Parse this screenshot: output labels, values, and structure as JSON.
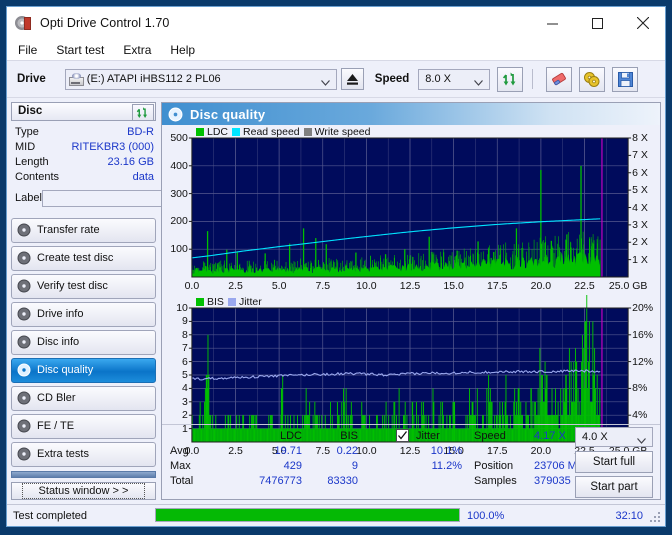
{
  "window": {
    "title": "Opti Drive Control 1.70",
    "icon": "optical-disc-icon",
    "minimize": "minimize",
    "maximize": "maximize",
    "close": "close"
  },
  "menu": {
    "items": [
      "File",
      "Start test",
      "Extra",
      "Help"
    ]
  },
  "toolbar": {
    "drive_label": "Drive",
    "drive_value": "(E:)   ATAPI iHBS112  2 PL06",
    "eject": "eject",
    "speed_label": "Speed",
    "speed_value": "8.0 X",
    "refresh_icon": "refresh-icon",
    "erase_icon": "erase-icon",
    "discs_icon": "discs-icon",
    "save_icon": "save-icon"
  },
  "disc": {
    "header": "Disc",
    "refresh_icon": "refresh-icon",
    "rows": [
      {
        "key": "Type",
        "value": "BD-R"
      },
      {
        "key": "MID",
        "value": "RITEKBR3 (000)"
      },
      {
        "key": "Length",
        "value": "23.16 GB"
      },
      {
        "key": "Contents",
        "value": "data"
      }
    ],
    "label_key": "Label",
    "label_value": "",
    "label_placeholder": "",
    "label_button_icon": "disc-label-icon"
  },
  "nav": {
    "items": [
      {
        "label": "Transfer rate",
        "selected": false
      },
      {
        "label": "Create test disc",
        "selected": false
      },
      {
        "label": "Verify test disc",
        "selected": false
      },
      {
        "label": "Drive info",
        "selected": false
      },
      {
        "label": "Disc info",
        "selected": false
      },
      {
        "label": "Disc quality",
        "selected": true
      },
      {
        "label": "CD Bler",
        "selected": false
      },
      {
        "label": "FE / TE",
        "selected": false
      },
      {
        "label": "Extra tests",
        "selected": false
      }
    ],
    "status_window": "Status window > >"
  },
  "panel": {
    "title": "Disc quality",
    "icon": "disc-quality-icon"
  },
  "stats": {
    "col_ldc": "LDC",
    "col_bis": "BIS",
    "row_avg": "Avg",
    "row_max": "Max",
    "row_total": "Total",
    "ldc_avg": "19.71",
    "ldc_max": "429",
    "ldc_total": "7476773",
    "bis_avg": "0.22",
    "bis_max": "9",
    "bis_total": "83330",
    "jitter_label": "Jitter",
    "jitter_checked": true,
    "jitter_avg": "10.1%",
    "jitter_max": "11.2%",
    "speed_label": "Speed",
    "speed_value": "4.17 X",
    "position_label": "Position",
    "position_value": "23706 MB",
    "samples_label": "Samples",
    "samples_value": "379035",
    "speed_select": "4.0 X",
    "start_full": "Start full",
    "start_part": "Start part"
  },
  "statusbar": {
    "text": "Test completed",
    "progress_pct": 100,
    "progress_label": "100.0%",
    "elapsed": "32:10"
  },
  "colors": {
    "ldc_green": "#00c000",
    "read_speed_cyan": "#00e5ff",
    "write_speed_gray": "#808080",
    "bis_green": "#00c000",
    "jitter_periwinkle": "#9aa8ee",
    "plot_bg": "#000b5c",
    "grid": "#55598f",
    "accent_blue": "#1b37c9",
    "marker_magenta": "#c000c0"
  },
  "chart_data": [
    {
      "type": "area",
      "id": "ldc-chart",
      "title": "",
      "xlabel": "GB",
      "ylabel": "",
      "xlim": [
        0,
        25
      ],
      "ylim": [
        0,
        500
      ],
      "y2lim": [
        0,
        8
      ],
      "y2label": "X",
      "grid": true,
      "legend": [
        "LDC",
        "Read speed",
        "Write speed"
      ],
      "legend_position": "top-left",
      "xticks": [
        "0.0",
        "2.5",
        "5.0",
        "7.5",
        "10.0",
        "12.5",
        "15.0",
        "17.5",
        "20.0",
        "22.5",
        "25.0"
      ],
      "xtick_values": [
        0,
        2.5,
        5,
        7.5,
        10,
        12.5,
        15,
        17.5,
        20,
        22.5,
        25
      ],
      "yticks": [
        "100",
        "200",
        "300",
        "400",
        "500"
      ],
      "ytick_values": [
        100,
        200,
        300,
        400,
        500
      ],
      "y2ticks": [
        "1 X",
        "2 X",
        "3 X",
        "4 X",
        "5 X",
        "6 X",
        "7 X",
        "8 X"
      ],
      "y2tick_values": [
        1,
        2,
        3,
        4,
        5,
        6,
        7,
        8
      ],
      "x_unit_label": "25.0 GB",
      "data_end_x": 23.4,
      "marker_x": 23.5,
      "series": [
        {
          "name": "LDC",
          "color": "#00c000",
          "kind": "area-spikes",
          "x": [
            0.0,
            0.3,
            0.6,
            0.9,
            1.2,
            1.5,
            1.8,
            2.1,
            2.4,
            2.7,
            3.0,
            3.3,
            3.6,
            3.9,
            4.2,
            4.5,
            4.8,
            5.1,
            5.4,
            5.7,
            6.0,
            6.3,
            6.6,
            6.9,
            7.2,
            7.5,
            7.8,
            8.1,
            8.4,
            8.7,
            9.0,
            9.3,
            9.6,
            9.9,
            10.2,
            10.5,
            10.8,
            11.1,
            11.4,
            11.7,
            12.0,
            12.3,
            12.6,
            12.9,
            13.2,
            13.5,
            13.8,
            14.1,
            14.4,
            14.7,
            15.0,
            15.3,
            15.6,
            15.9,
            16.2,
            16.5,
            16.8,
            17.1,
            17.4,
            17.7,
            18.0,
            18.3,
            18.6,
            18.9,
            19.2,
            19.5,
            19.8,
            20.1,
            20.4,
            20.7,
            21.0,
            21.3,
            21.6,
            21.9,
            22.2,
            22.5,
            22.8,
            23.1,
            23.4
          ],
          "baseline": [
            18,
            22,
            20,
            24,
            19,
            21,
            23,
            20,
            22,
            19,
            21,
            24,
            22,
            20,
            23,
            21,
            25,
            22,
            24,
            21,
            23,
            26,
            24,
            22,
            25,
            23,
            27,
            25,
            24,
            26,
            28,
            25,
            27,
            26,
            29,
            27,
            30,
            28,
            31,
            29,
            32,
            30,
            33,
            31,
            34,
            32,
            36,
            34,
            37,
            35,
            38,
            36,
            40,
            38,
            42,
            40,
            44,
            42,
            46,
            44,
            48,
            46,
            50,
            48,
            52,
            50,
            54,
            52,
            56,
            54,
            58,
            56,
            60,
            58,
            62,
            60,
            64,
            62,
            60
          ],
          "spikes": [
            {
              "x": 0.9,
              "y": 165
            },
            {
              "x": 2.0,
              "y": 98
            },
            {
              "x": 2.6,
              "y": 92
            },
            {
              "x": 4.2,
              "y": 85
            },
            {
              "x": 5.6,
              "y": 120
            },
            {
              "x": 6.4,
              "y": 175
            },
            {
              "x": 7.1,
              "y": 140
            },
            {
              "x": 7.7,
              "y": 118
            },
            {
              "x": 9.4,
              "y": 88
            },
            {
              "x": 11.1,
              "y": 82
            },
            {
              "x": 12.2,
              "y": 100
            },
            {
              "x": 13.6,
              "y": 145
            },
            {
              "x": 15.2,
              "y": 95
            },
            {
              "x": 16.4,
              "y": 128
            },
            {
              "x": 17.3,
              "y": 90
            },
            {
              "x": 18.6,
              "y": 175
            },
            {
              "x": 20.0,
              "y": 385
            },
            {
              "x": 20.6,
              "y": 130
            },
            {
              "x": 22.3,
              "y": 400
            },
            {
              "x": 23.0,
              "y": 120
            }
          ]
        },
        {
          "name": "Read speed",
          "color": "#00e5ff",
          "kind": "line",
          "x": [
            0.0,
            1.0,
            2.0,
            3.0,
            4.0,
            5.0,
            6.0,
            7.0,
            8.0,
            9.0,
            10.0,
            11.0,
            12.0,
            13.0,
            14.0,
            15.0,
            16.0,
            17.0,
            18.0,
            19.0,
            20.0,
            21.0,
            22.0,
            23.0,
            23.4
          ],
          "y2": [
            1.1,
            1.22,
            1.36,
            1.5,
            1.62,
            1.75,
            1.86,
            1.98,
            2.1,
            2.22,
            2.33,
            2.44,
            2.55,
            2.65,
            2.74,
            2.83,
            2.91,
            2.99,
            3.06,
            3.12,
            3.18,
            3.23,
            3.28,
            3.33,
            3.35
          ]
        },
        {
          "name": "Write speed",
          "color": "#808080",
          "kind": "line",
          "x": [],
          "y2": []
        }
      ]
    },
    {
      "type": "bar",
      "id": "bis-chart",
      "title": "",
      "xlabel": "GB",
      "ylabel": "",
      "xlim": [
        0,
        25
      ],
      "ylim": [
        0,
        10
      ],
      "y2lim": [
        0,
        20
      ],
      "y2label": "%",
      "grid": true,
      "legend": [
        "BIS",
        "Jitter"
      ],
      "legend_position": "top-left",
      "xticks": [
        "0.0",
        "2.5",
        "5.0",
        "7.5",
        "10.0",
        "12.5",
        "15.0",
        "17.5",
        "20.0",
        "22.5",
        "25.0"
      ],
      "xtick_values": [
        0,
        2.5,
        5,
        7.5,
        10,
        12.5,
        15,
        17.5,
        20,
        22.5,
        25
      ],
      "yticks": [
        "1",
        "2",
        "3",
        "4",
        "5",
        "6",
        "7",
        "8",
        "9",
        "10"
      ],
      "ytick_values": [
        1,
        2,
        3,
        4,
        5,
        6,
        7,
        8,
        9,
        10
      ],
      "y2ticks": [
        "4%",
        "8%",
        "12%",
        "16%",
        "20%"
      ],
      "y2tick_values": [
        4,
        8,
        12,
        16,
        20
      ],
      "x_unit_label": "25.0 GB",
      "data_end_x": 23.4,
      "marker_x": 23.5,
      "series": [
        {
          "name": "BIS",
          "color": "#00c000",
          "kind": "bars",
          "x": [
            0.0,
            0.3,
            0.6,
            0.9,
            1.2,
            1.5,
            1.8,
            2.1,
            2.4,
            2.7,
            3.0,
            3.3,
            3.6,
            3.9,
            4.2,
            4.5,
            4.8,
            5.1,
            5.4,
            5.7,
            6.0,
            6.3,
            6.6,
            6.9,
            7.2,
            7.5,
            7.8,
            8.1,
            8.4,
            8.7,
            9.0,
            9.3,
            9.6,
            9.9,
            10.2,
            10.5,
            10.8,
            11.1,
            11.4,
            11.7,
            12.0,
            12.3,
            12.6,
            12.9,
            13.2,
            13.5,
            13.8,
            14.1,
            14.4,
            14.7,
            15.0,
            15.3,
            15.6,
            15.9,
            16.2,
            16.5,
            16.8,
            17.1,
            17.4,
            17.7,
            18.0,
            18.3,
            18.6,
            18.9,
            19.2,
            19.5,
            19.8,
            20.1,
            20.4,
            20.7,
            21.0,
            21.3,
            21.6,
            21.9,
            22.2,
            22.5,
            22.8,
            23.1,
            23.4
          ],
          "values": [
            1,
            1,
            2,
            5,
            1,
            2,
            1,
            2,
            1,
            1,
            2,
            1,
            2,
            1,
            1,
            2,
            1,
            3,
            2,
            1,
            1,
            2,
            4,
            1,
            2,
            1,
            2,
            1,
            2,
            3,
            1,
            2,
            1,
            2,
            1,
            2,
            1,
            2,
            1,
            3,
            1,
            2,
            1,
            2,
            3,
            1,
            2,
            1,
            2,
            1,
            3,
            2,
            1,
            2,
            3,
            1,
            2,
            3,
            1,
            2,
            3,
            2,
            4,
            2,
            3,
            2,
            4,
            5,
            3,
            4,
            2,
            5,
            4,
            6,
            3,
            9,
            5,
            4,
            4
          ]
        },
        {
          "name": "Jitter",
          "color": "#9aa8ee",
          "kind": "line",
          "x": [
            0.0,
            0.5,
            1.0,
            1.5,
            2.0,
            2.5,
            3.0,
            3.5,
            4.0,
            4.5,
            5.0,
            5.5,
            6.0,
            6.5,
            7.0,
            7.5,
            8.0,
            8.5,
            9.0,
            9.5,
            10.0,
            10.5,
            11.0,
            11.5,
            12.0,
            12.5,
            13.0,
            13.5,
            14.0,
            14.5,
            15.0,
            15.5,
            16.0,
            16.5,
            17.0,
            17.5,
            18.0,
            18.5,
            19.0,
            19.5,
            20.0,
            20.5,
            21.0,
            21.5,
            22.0,
            22.5,
            23.0,
            23.4
          ],
          "y2": [
            9.5,
            9.4,
            9.5,
            9.5,
            9.6,
            9.6,
            9.7,
            9.7,
            9.8,
            9.8,
            9.9,
            9.9,
            10.0,
            10.0,
            10.1,
            10.1,
            10.1,
            10.2,
            10.2,
            10.2,
            10.1,
            10.1,
            10.0,
            10.0,
            10.1,
            10.2,
            10.2,
            10.3,
            10.3,
            10.3,
            10.3,
            10.4,
            10.4,
            10.4,
            10.4,
            10.5,
            10.5,
            10.5,
            10.5,
            10.5,
            10.5,
            10.5,
            10.5,
            10.6,
            10.6,
            10.6,
            10.6,
            10.6
          ]
        }
      ]
    }
  ]
}
